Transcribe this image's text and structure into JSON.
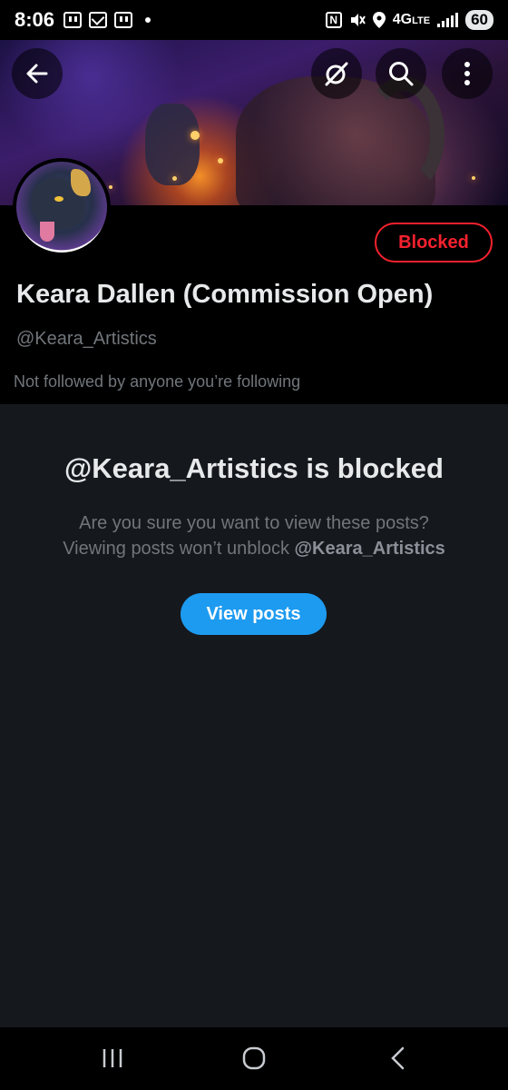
{
  "status_bar": {
    "time": "8:06",
    "network": "4G",
    "network_sub": "LTE",
    "battery": "60"
  },
  "header": {
    "back_icon": "arrow-left-icon",
    "grok_icon": "grok-icon",
    "search_icon": "search-icon",
    "more_icon": "more-vertical-icon"
  },
  "profile": {
    "blocked_label": "Blocked",
    "display_name": "Keara Dallen (Commission Open)",
    "handle": "@Keara_Artistics",
    "followed_note": "Not followed by anyone you’re following"
  },
  "blocked_notice": {
    "title": "@Keara_Artistics is blocked",
    "line1": "Are you sure you want to view these posts?",
    "line2_prefix": "Viewing posts won’t unblock ",
    "line2_handle": "@Keara_Artistics",
    "button_label": "View posts"
  },
  "colors": {
    "accent": "#1d9bf0",
    "blocked_red": "#f4212e",
    "background": "#15181d",
    "secondary_text": "#71767b"
  },
  "nav_bar": {
    "recent_icon": "recent-apps-icon",
    "home_icon": "home-icon",
    "back_icon": "back-chevron-icon"
  }
}
